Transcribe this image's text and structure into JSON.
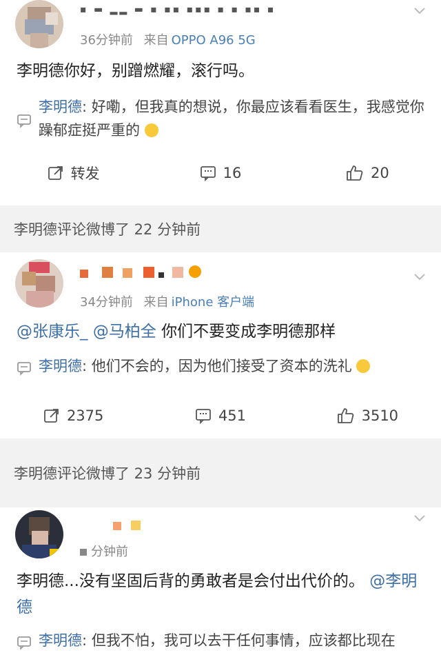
{
  "c1": {
    "username": "▪ ▬ ▂▂ ▬ ▪ ▪▪ ▪▪▪ ▪ ▪ ▪▪ ▪",
    "time": "36分钟前",
    "from": "来自",
    "device": "OPPO A96 5G",
    "text": "李明德你好，别蹭燃耀，滚行吗。",
    "reply_name": "李明德",
    "reply_text": ": 好嘞，但我真的想说，你最应该看看医生，我感觉你躁郁症挺严重的",
    "repost_label": "转发",
    "comments": "16",
    "likes": "20"
  },
  "label1": "李明德评论微博了 22 分钟前",
  "c2": {
    "username": "▪▪ ▪ ▪ ▪▪ ▪ ▪ ▪",
    "time": "34分钟前",
    "from": "来自",
    "device": "iPhone 客户端",
    "mention1": "@张康乐_",
    "mention2": "@马柏全",
    "text": " 你们不要变成李明德那样",
    "reply_name": "李明德",
    "reply_text": ": 他们不会的，因为他们接受了资本的洗礼",
    "reposts": "2375",
    "comments": "451",
    "likes": "3510"
  },
  "label2": "李明德评论微博了 23 分钟前",
  "c3": {
    "time": "分钟前",
    "text": "李明德...没有坚固后背的勇敢者是会付出代价的。",
    "mention": "@李明德",
    "reply_name": "李明德",
    "reply_text": ": 但我不怕，我可以去干任何事情，应该都比现在"
  },
  "colors": {
    "link": "#3d6fa6",
    "meta": "#888888",
    "bg": "#f2f2f2"
  }
}
